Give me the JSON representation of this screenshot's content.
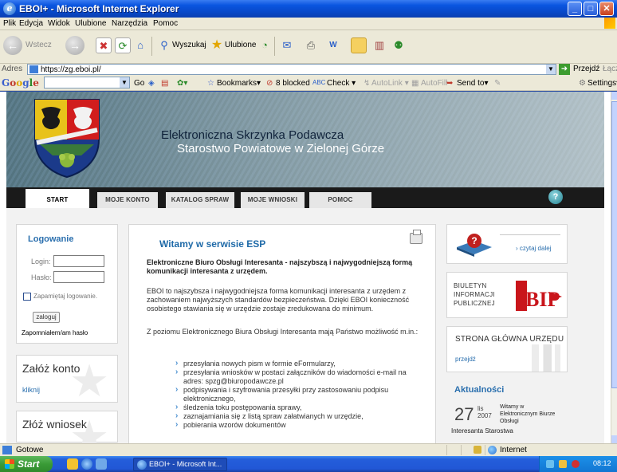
{
  "window": {
    "title": "EBOI+ - Microsoft Internet Explorer",
    "controls": [
      "minimize",
      "maximize",
      "close"
    ]
  },
  "menubar": {
    "items": [
      "Plik",
      "Edycja",
      "Widok",
      "Ulubione",
      "Narzędzia",
      "Pomoc"
    ]
  },
  "toolbar": {
    "back_label": "Wstecz",
    "search_label": "Wyszukaj",
    "favorites_label": "Ulubione"
  },
  "addressbar": {
    "label": "Adres",
    "url": "https://zg.eboi.pl/",
    "go_label": "Przejdź",
    "links_label": "Łącza"
  },
  "googlebar": {
    "logo": "Google",
    "go_label": "Go",
    "bookmarks_label": "Bookmarks▾",
    "blocked_label": "8 blocked",
    "check_label": "Check ▾",
    "autolink_label": "AutoLink ▾",
    "autofill_label": "AutoFill",
    "sendto_label": "Send to▾",
    "settings_label": "Settings▾"
  },
  "site": {
    "header_line1": "Elektroniczna Skrzynka Podawcza",
    "header_line2": "Starostwo Powiatowe w Zielonej Górze",
    "nav": [
      "START",
      "MOJE KONTO",
      "KATALOG SPRAW",
      "MOJE WNIOSKI",
      "POMOC"
    ],
    "help_icon_label": "?"
  },
  "login": {
    "title": "Logowanie",
    "login_label": "Login:",
    "password_label": "Hasło:",
    "login_value": "",
    "password_value": "",
    "remember_label": "Zapamiętaj logowanie.",
    "submit_label": "zaloguj",
    "forgot_label": "Zapomniałem/am hasło"
  },
  "sideboxes": {
    "account_title": "Załóż konto",
    "account_link": "kliknij",
    "request_title": "Złóż wniosek"
  },
  "welcome": {
    "title": "Witamy w serwisie ESP",
    "intro_bold": "Elektroniczne Biuro Obsługi Interesanta - najszybszą i najwygodniejszą formą komunikacji interesanta z urzędem.",
    "para1": "EBOI to najszybsza i najwygodniejsza forma komunikacji interesanta z urzędem z zachowaniem najwyższych standardów bezpieczeństwa. Dzięki EBOI konieczność osobistego stawiania się w urzędzie zostaje zredukowana do minimum.",
    "para2": "Z poziomu Elektronicznego Biura Obsługi Interesanta mają Państwo możliwość m.in.:",
    "bullets": [
      "przesyłania nowych pism w formie eFormularzy,",
      "przesyłania wniosków w postaci załączników do wiadomości e-mail na adres: spzg@biuropodawcze.pl",
      "podpisywania i szyfrowania przesyłki przy zastosowaniu podpisu elektronicznego,",
      "śledzenia toku postępowania sprawy,",
      "zaznajamiania się z listą spraw załatwianych w urzędzie,",
      "pobierania wzorów dokumentów"
    ]
  },
  "right": {
    "readmore_label": "› czytaj dalej",
    "bip_lines": [
      "BIULETYN",
      "INFORMACJI",
      "PUBLICZNEJ"
    ],
    "bip_logo": "BIP",
    "homepage_title": "STRONA GŁÓWNA URZĘDU",
    "homepage_link": "przejdź",
    "news_title": "Aktualności",
    "news_day": "27",
    "news_month": "lis",
    "news_year": "2007",
    "news_text": "Witamy w Elektronicznym Biurze Obsługi",
    "news_text2": "Interesanta Starostwa"
  },
  "statusbar": {
    "status": "Gotowe",
    "zone": "Internet"
  },
  "taskbar": {
    "start_label": "Start",
    "task_label": "EBOI+ - Microsoft Int...",
    "clock": "08:12"
  }
}
